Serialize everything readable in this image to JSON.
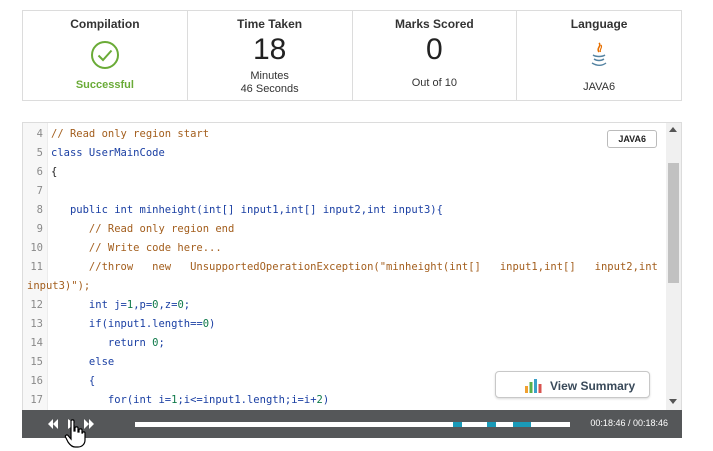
{
  "stats": {
    "compilation": {
      "title": "Compilation",
      "status": "Successful",
      "icon": "check-circle-icon",
      "color": "#6aab37"
    },
    "time_taken": {
      "title": "Time Taken",
      "value": "18",
      "unit": "Minutes",
      "detail": "46 Seconds"
    },
    "marks": {
      "title": "Marks Scored",
      "value": "0",
      "detail": "Out of 10"
    },
    "language": {
      "title": "Language",
      "name": "JAVA6",
      "icon": "java-icon"
    }
  },
  "editor": {
    "language_badge": "JAVA6",
    "lines": [
      {
        "num": "4",
        "segments": [
          {
            "cls": "c-comment",
            "text": "// Read only region start"
          }
        ]
      },
      {
        "num": "5",
        "segments": [
          {
            "cls": "c-kw",
            "text": "class UserMainCode"
          }
        ]
      },
      {
        "num": "6",
        "segments": [
          {
            "cls": "c-plain",
            "text": "{"
          }
        ]
      },
      {
        "num": "7",
        "segments": []
      },
      {
        "num": "8",
        "segments": [
          {
            "cls": "c-kw",
            "text": "   public int minheight(int[] input1,int[] input2,int input3){"
          }
        ]
      },
      {
        "num": "9",
        "segments": [
          {
            "cls": "c-comment",
            "text": "      // Read only region end"
          }
        ]
      },
      {
        "num": "10",
        "segments": [
          {
            "cls": "c-comment",
            "text": "      // Write code here..."
          }
        ]
      },
      {
        "num": "11",
        "segments": [
          {
            "cls": "c-comment",
            "text": "      //throw   new   UnsupportedOperationException(\"minheight(int[]   input1,int[]   input2,int"
          }
        ]
      },
      {
        "num": "",
        "wrap": true,
        "segments": [
          {
            "cls": "c-comment",
            "text": "input3)\");"
          }
        ]
      },
      {
        "num": "12",
        "segments": [
          {
            "cls": "c-kw",
            "text": "      int j="
          },
          {
            "cls": "c-num",
            "text": "1"
          },
          {
            "cls": "c-kw",
            "text": ",p="
          },
          {
            "cls": "c-num",
            "text": "0"
          },
          {
            "cls": "c-kw",
            "text": ",z="
          },
          {
            "cls": "c-num",
            "text": "0"
          },
          {
            "cls": "c-kw",
            "text": ";"
          }
        ]
      },
      {
        "num": "13",
        "segments": [
          {
            "cls": "c-kw",
            "text": "      if(input1.length=="
          },
          {
            "cls": "c-num",
            "text": "0"
          },
          {
            "cls": "c-kw",
            "text": ")"
          }
        ]
      },
      {
        "num": "14",
        "segments": [
          {
            "cls": "c-kw",
            "text": "         return "
          },
          {
            "cls": "c-num",
            "text": "0"
          },
          {
            "cls": "c-kw",
            "text": ";"
          }
        ]
      },
      {
        "num": "15",
        "segments": [
          {
            "cls": "c-kw",
            "text": "      else"
          }
        ]
      },
      {
        "num": "16",
        "segments": [
          {
            "cls": "c-kw",
            "text": "      {"
          }
        ]
      },
      {
        "num": "17",
        "segments": [
          {
            "cls": "c-kw",
            "text": "         for(int i="
          },
          {
            "cls": "c-num",
            "text": "1"
          },
          {
            "cls": "c-kw",
            "text": ";i<=input1.length;i=i+"
          },
          {
            "cls": "c-num",
            "text": "2"
          },
          {
            "cls": "c-kw",
            "text": ")"
          }
        ]
      }
    ]
  },
  "summary_button": {
    "label": "View Summary",
    "icon": "bar-chart-icon"
  },
  "player": {
    "time": "00:18:46 / 00:18:46",
    "progress_markers": [
      0.73,
      0.81,
      0.87
    ]
  }
}
